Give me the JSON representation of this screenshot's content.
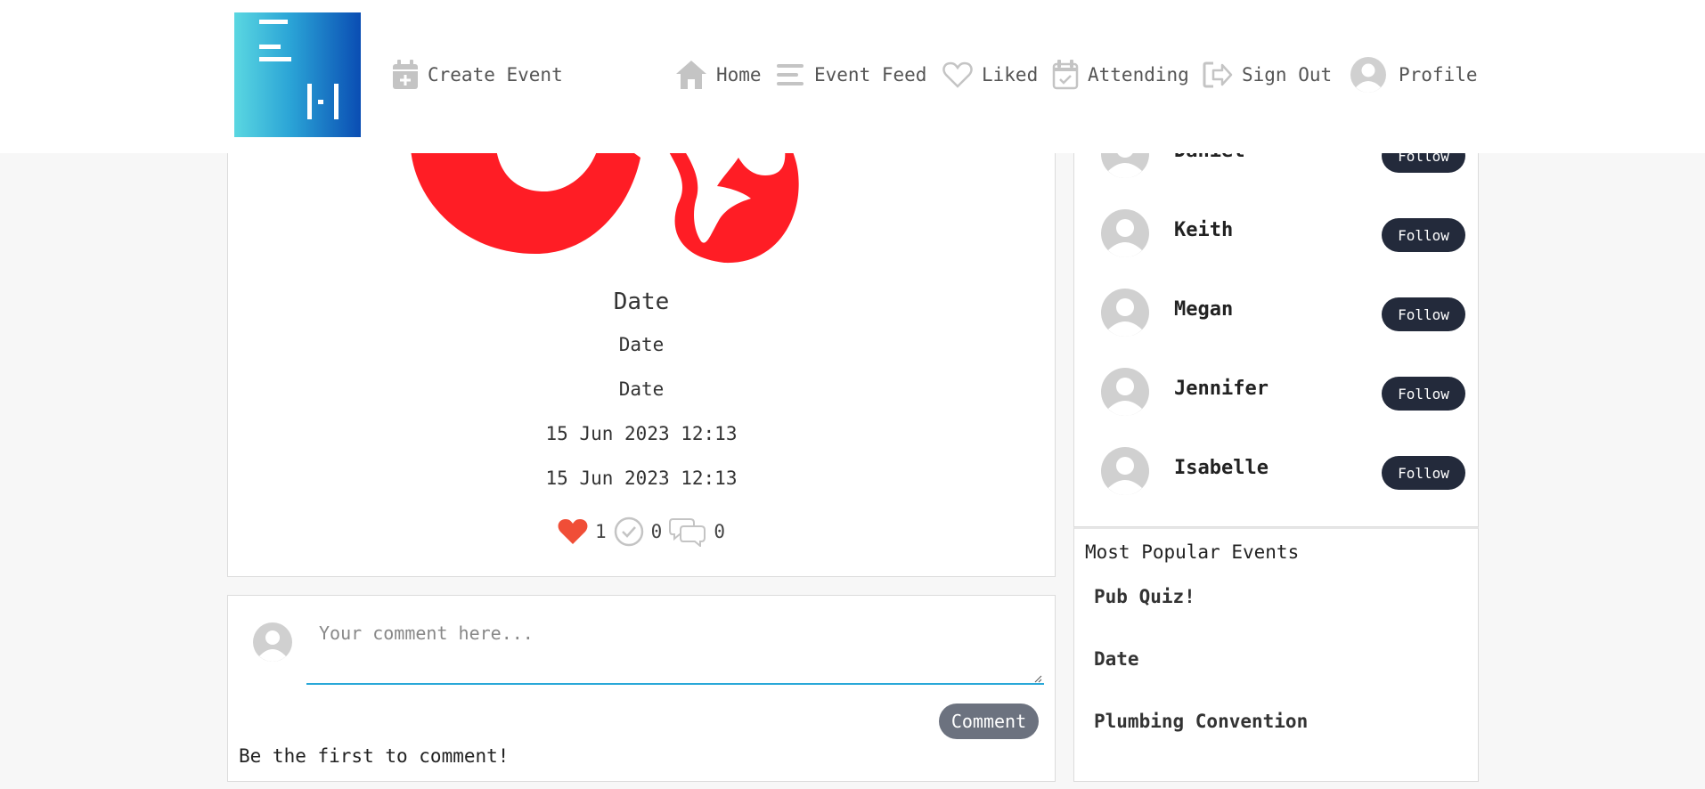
{
  "nav": {
    "create_event": "Create Event",
    "home": "Home",
    "event_feed": "Event Feed",
    "liked": "Liked",
    "attending": "Attending",
    "sign_out": "Sign Out",
    "profile": "Profile"
  },
  "event": {
    "title": "Date",
    "subtitle": "Date",
    "location": "Date",
    "start": "15 Jun 2023 12:13",
    "end": "15 Jun 2023 12:13",
    "likes": "1",
    "attending": "0",
    "comments": "0"
  },
  "comment_box": {
    "placeholder": "Your comment here...",
    "button_label": "Comment",
    "empty_text": "Be the first to comment!"
  },
  "people": {
    "follow_label": "Follow",
    "users": [
      {
        "name": "Daniel"
      },
      {
        "name": "Keith"
      },
      {
        "name": "Megan"
      },
      {
        "name": "Jennifer"
      },
      {
        "name": "Isabelle"
      }
    ]
  },
  "popular": {
    "title": "Most Popular Events",
    "items": [
      "Pub Quiz!",
      "Date",
      "Plumbing Convention"
    ]
  },
  "colors": {
    "accent_blue": "#29a8d8",
    "follow_button": "#232a3b",
    "comment_button": "#6c727f",
    "heart": "#f04e37",
    "event_art": "#ff1d25"
  }
}
